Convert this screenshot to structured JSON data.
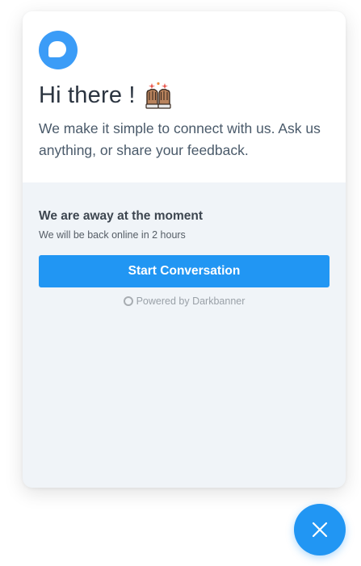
{
  "header": {
    "greeting": "Hi there !",
    "greeting_emoji": "raised-hands-emoji",
    "intro": "We make it simple to connect with us. Ask us anything, or share your feedback."
  },
  "status": {
    "title": "We are away at the moment",
    "subtitle": "We will be back online in 2 hours"
  },
  "actions": {
    "start_label": "Start Conversation"
  },
  "footer": {
    "powered_by": "Powered by Darkbanner"
  },
  "icons": {
    "logo": "chat-bubble-icon",
    "close": "close-icon"
  },
  "colors": {
    "accent": "#2196f3",
    "logo": "#3b9cf7",
    "panel": "#f0f4f8"
  }
}
